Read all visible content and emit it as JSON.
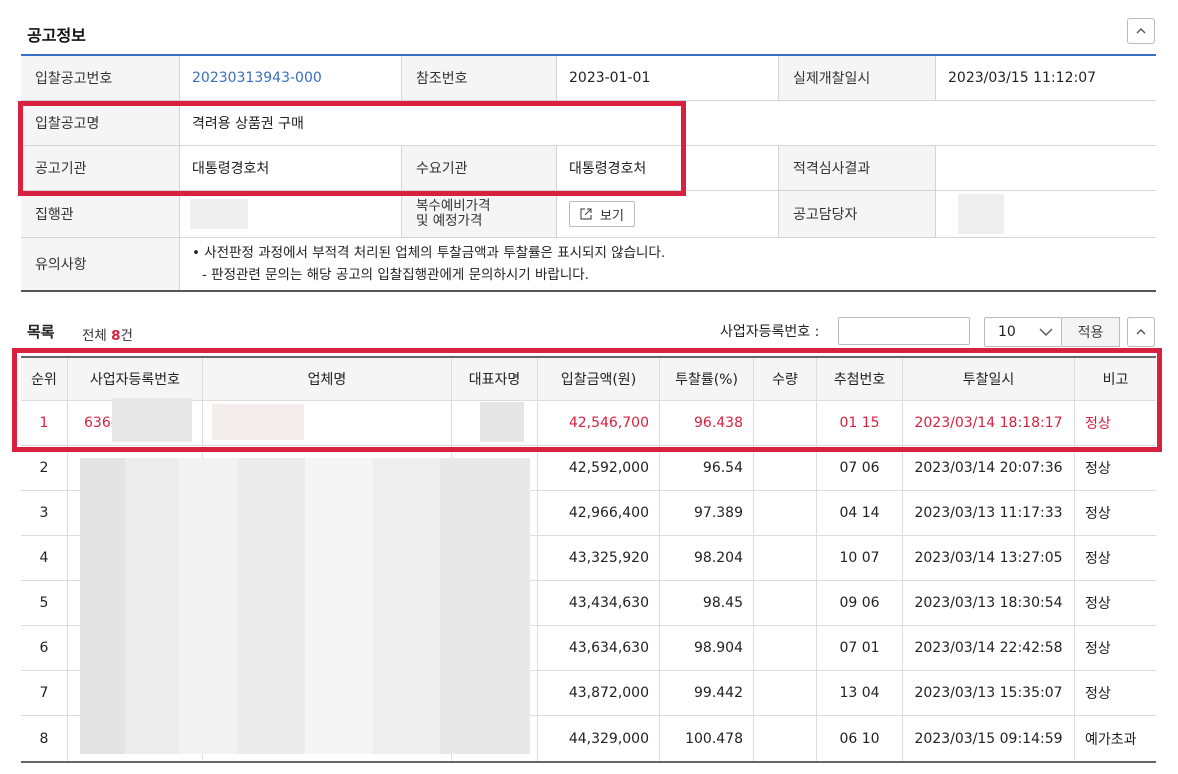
{
  "section_title": "공고정보",
  "info": {
    "bid_no_label": "입찰공고번호",
    "bid_no": "20230313943-000",
    "ref_no_label": "참조번호",
    "ref_no": "2023-01-01",
    "open_date_label": "실제개찰일시",
    "open_date": "2023/03/15 11:12:07",
    "bid_name_label": "입찰공고명",
    "bid_name": "격려용 상품권 구매",
    "agency_label": "공고기관",
    "agency": "대통령경호처",
    "demand_label": "수요기관",
    "demand": "대통령경호처",
    "eligibility_label": "적격심사결과",
    "executor_label": "집행관",
    "multi_price_label_1": "복수예비가격",
    "multi_price_label_2": "및 예정가격",
    "view_button": "보기",
    "officer_label": "공고담당자",
    "notes_label": "유의사항",
    "note_1": "• 사전판정 과정에서 부적격 처리된 업체의 투찰금액과 투찰률은 표시되지 않습니다.",
    "note_2": "- 판정관련 문의는 해당 공고의 입찰집행관에게 문의하시기 바랍니다."
  },
  "list": {
    "title": "목록",
    "count_prefix": "전체",
    "count": "8",
    "count_suffix": "건",
    "biz_no_label": "사업자등록번호 :",
    "page_size": "10",
    "apply_button": "적용"
  },
  "columns": [
    "순위",
    "사업자등록번호",
    "업체명",
    "대표자명",
    "입찰금액(원)",
    "투찰률(%)",
    "수량",
    "추첨번호",
    "투찰일시",
    "비고"
  ],
  "rows": [
    {
      "rank": "1",
      "biz": "636-",
      "amount": "42,546,700",
      "rate": "96.438",
      "lottery": "01 15",
      "date": "2023/03/14 18:18:17",
      "note": "정상",
      "highlight": true
    },
    {
      "rank": "2",
      "biz": "",
      "amount": "42,592,000",
      "rate": "96.54",
      "lottery": "07 06",
      "date": "2023/03/14 20:07:36",
      "note": "정상"
    },
    {
      "rank": "3",
      "biz": "",
      "amount": "42,966,400",
      "rate": "97.389",
      "lottery": "04 14",
      "date": "2023/03/13 11:17:33",
      "note": "정상"
    },
    {
      "rank": "4",
      "biz": "",
      "amount": "43,325,920",
      "rate": "98.204",
      "lottery": "10 07",
      "date": "2023/03/14 13:27:05",
      "note": "정상"
    },
    {
      "rank": "5",
      "biz": "",
      "amount": "43,434,630",
      "rate": "98.45",
      "lottery": "09 06",
      "date": "2023/03/13 18:30:54",
      "note": "정상"
    },
    {
      "rank": "6",
      "biz": "",
      "amount": "43,634,630",
      "rate": "98.904",
      "lottery": "07 01",
      "date": "2023/03/14 22:42:58",
      "note": "정상"
    },
    {
      "rank": "7",
      "biz": "",
      "amount": "43,872,000",
      "rate": "99.442",
      "lottery": "13 04",
      "date": "2023/03/13 15:35:07",
      "note": "정상"
    },
    {
      "rank": "8",
      "biz": "",
      "amount": "44,329,000",
      "rate": "100.478",
      "lottery": "06 10",
      "date": "2023/03/15 09:14:59",
      "note": "예가초과"
    }
  ],
  "colors": {
    "accent": "#3b6fc4",
    "highlight_red": "#d8213f"
  }
}
